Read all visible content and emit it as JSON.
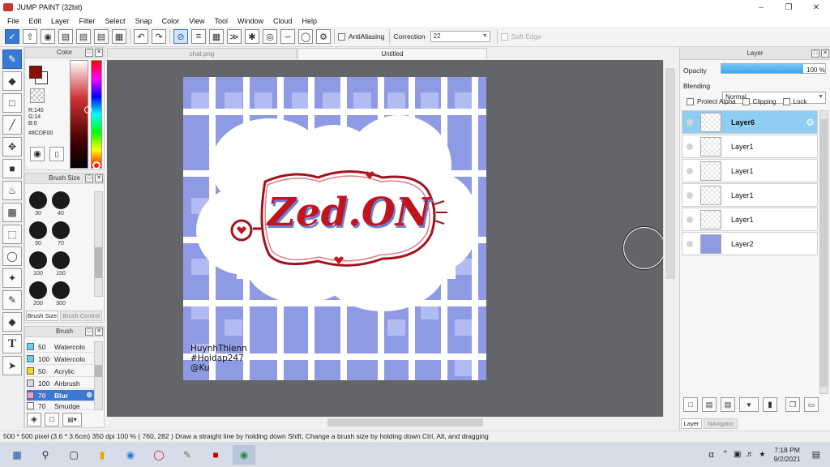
{
  "window": {
    "title": "JUMP PAINT (32bit)"
  },
  "menu": [
    "File",
    "Edit",
    "Layer",
    "Filter",
    "Select",
    "Snap",
    "Color",
    "View",
    "Tool",
    "Window",
    "Cloud",
    "Help"
  ],
  "toolbar": {
    "antialiasing_label": "AntiAliasing",
    "correction_label": "Correction",
    "correction_value": "22",
    "softedge_label": "Soft Edge"
  },
  "color_panel": {
    "title": "Color",
    "r": "R:140",
    "g": "G:14",
    "b": "B:0",
    "hex": "#8CDE00",
    "fg_color": "#8c0e00"
  },
  "brush_size_panel": {
    "title": "Brush Size",
    "sizes": [
      "30",
      "40",
      "50",
      "70",
      "100",
      "150",
      "200",
      "300"
    ],
    "tab_active": "Brush Size",
    "tab_inactive": "Brush Control"
  },
  "brush_panel": {
    "title": "Brush",
    "items": [
      {
        "size": "50",
        "name": "Watercolo",
        "color": "#5fd3f0"
      },
      {
        "size": "100",
        "name": "Watercolo",
        "color": "#5fd3f0"
      },
      {
        "size": "50",
        "name": "Acrylic",
        "color": "#f2d714"
      },
      {
        "size": "100",
        "name": "Airbrush",
        "color": "#d9d9d9"
      },
      {
        "size": "70",
        "name": "Blur",
        "color": "#f29ad3"
      },
      {
        "size": "70",
        "name": "Smudge",
        "color": "#ffffff"
      }
    ]
  },
  "tabs": [
    "chat.png",
    "Untitled"
  ],
  "canvas": {
    "logo_text": "Zed.ON",
    "credit_lines": [
      "HuynhThienn",
      "#Hoidap247",
      "@Ku"
    ]
  },
  "layer_panel": {
    "title": "Layer",
    "opacity_label": "Opacity",
    "opacity_value": "100 %",
    "opacity_fraction": 1.0,
    "blending_label": "Blending",
    "blending_value": "Normal",
    "protect_alpha": "Protect Alpha",
    "clipping": "Clipping",
    "lock": "Lock",
    "layers": [
      "Layer6",
      "Layer1",
      "Layer1",
      "Layer1",
      "Layer1",
      "Layer2"
    ],
    "bottom_tabs": [
      "Layer",
      "Navigator"
    ]
  },
  "status": {
    "text": "500 * 500 pixel  (3.6 * 3.6cm)  350 dpi  100 %  ( 760, 282 )  Draw a straight line by holding down Shift, Change a brush size by holding down Ctrl, Alt, and dragging"
  },
  "taskbar": {
    "time": "7:18 PM",
    "date": "9/2/2021"
  }
}
